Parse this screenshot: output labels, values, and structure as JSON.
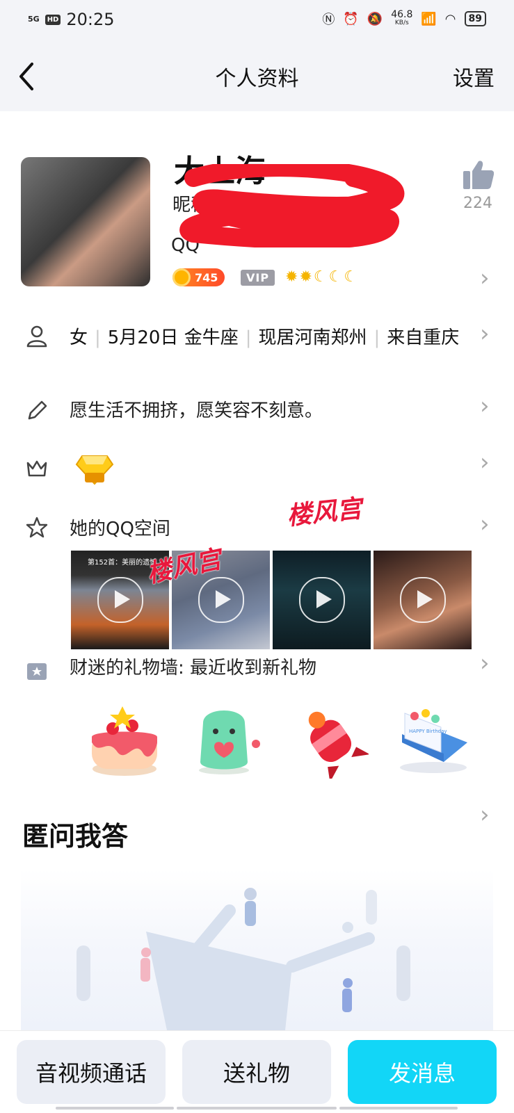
{
  "status_bar": {
    "time": "20:25",
    "signal": "5G",
    "hd": "HD",
    "speed_value": "46.8",
    "speed_unit": "KB/s",
    "battery": "89"
  },
  "header": {
    "title": "个人资料",
    "settings_label": "设置"
  },
  "profile": {
    "name": "大上海",
    "nickname_prefix": "昵称：",
    "qq_prefix": "QQ",
    "likes": "224",
    "coin_value": "745",
    "vip_label": "VIP"
  },
  "info": {
    "gender": "女",
    "birthday": "5月20日",
    "zodiac": "金牛座",
    "residence": "现居河南郑州",
    "hometown": "来自重庆",
    "signature": "愿生活不拥挤，愿笑容不刻意。"
  },
  "qzone": {
    "label": "她的QQ空间",
    "photo1_caption": "第152首：美丽的遗憾",
    "watermark": "楼风宫"
  },
  "gifts": {
    "label": "财迷的礼物墙: 最近收到新礼物",
    "items": [
      "cake-gift",
      "dino-gift",
      "rooster-candy-gift",
      "birthday-card-gift"
    ],
    "card_text": "HAPPY Birthday"
  },
  "qa": {
    "title": "匿问我答"
  },
  "actions": {
    "call": "音视频通话",
    "gift": "送礼物",
    "message": "发消息"
  },
  "colors": {
    "accent": "#12d6f7",
    "header_bg": "#f3f4f8",
    "watermark": "#e8183c"
  }
}
